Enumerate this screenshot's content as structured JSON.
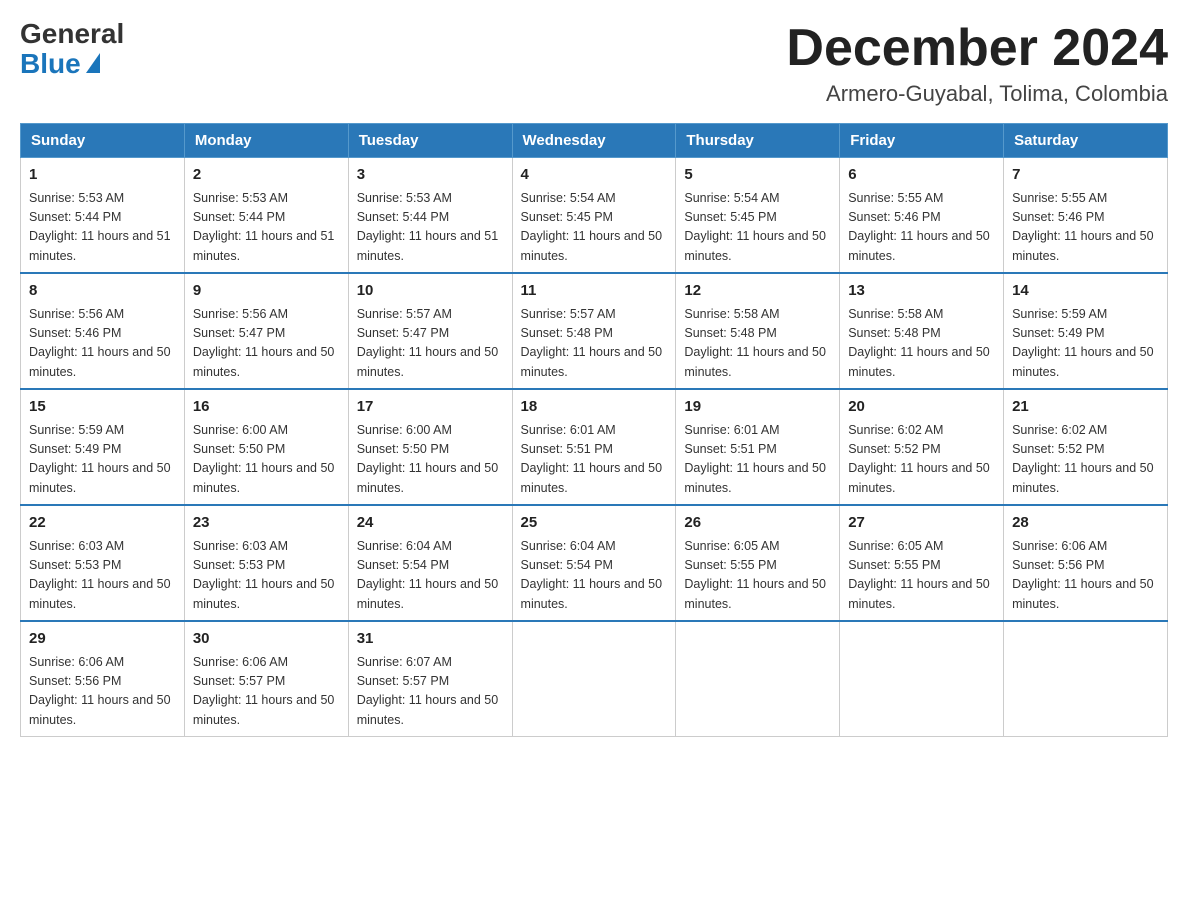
{
  "logo": {
    "general": "General",
    "blue": "Blue"
  },
  "header": {
    "month": "December 2024",
    "location": "Armero-Guyabal, Tolima, Colombia"
  },
  "days_of_week": [
    "Sunday",
    "Monday",
    "Tuesday",
    "Wednesday",
    "Thursday",
    "Friday",
    "Saturday"
  ],
  "weeks": [
    [
      {
        "day": "1",
        "sunrise": "5:53 AM",
        "sunset": "5:44 PM",
        "daylight": "11 hours and 51 minutes."
      },
      {
        "day": "2",
        "sunrise": "5:53 AM",
        "sunset": "5:44 PM",
        "daylight": "11 hours and 51 minutes."
      },
      {
        "day": "3",
        "sunrise": "5:53 AM",
        "sunset": "5:44 PM",
        "daylight": "11 hours and 51 minutes."
      },
      {
        "day": "4",
        "sunrise": "5:54 AM",
        "sunset": "5:45 PM",
        "daylight": "11 hours and 50 minutes."
      },
      {
        "day": "5",
        "sunrise": "5:54 AM",
        "sunset": "5:45 PM",
        "daylight": "11 hours and 50 minutes."
      },
      {
        "day": "6",
        "sunrise": "5:55 AM",
        "sunset": "5:46 PM",
        "daylight": "11 hours and 50 minutes."
      },
      {
        "day": "7",
        "sunrise": "5:55 AM",
        "sunset": "5:46 PM",
        "daylight": "11 hours and 50 minutes."
      }
    ],
    [
      {
        "day": "8",
        "sunrise": "5:56 AM",
        "sunset": "5:46 PM",
        "daylight": "11 hours and 50 minutes."
      },
      {
        "day": "9",
        "sunrise": "5:56 AM",
        "sunset": "5:47 PM",
        "daylight": "11 hours and 50 minutes."
      },
      {
        "day": "10",
        "sunrise": "5:57 AM",
        "sunset": "5:47 PM",
        "daylight": "11 hours and 50 minutes."
      },
      {
        "day": "11",
        "sunrise": "5:57 AM",
        "sunset": "5:48 PM",
        "daylight": "11 hours and 50 minutes."
      },
      {
        "day": "12",
        "sunrise": "5:58 AM",
        "sunset": "5:48 PM",
        "daylight": "11 hours and 50 minutes."
      },
      {
        "day": "13",
        "sunrise": "5:58 AM",
        "sunset": "5:48 PM",
        "daylight": "11 hours and 50 minutes."
      },
      {
        "day": "14",
        "sunrise": "5:59 AM",
        "sunset": "5:49 PM",
        "daylight": "11 hours and 50 minutes."
      }
    ],
    [
      {
        "day": "15",
        "sunrise": "5:59 AM",
        "sunset": "5:49 PM",
        "daylight": "11 hours and 50 minutes."
      },
      {
        "day": "16",
        "sunrise": "6:00 AM",
        "sunset": "5:50 PM",
        "daylight": "11 hours and 50 minutes."
      },
      {
        "day": "17",
        "sunrise": "6:00 AM",
        "sunset": "5:50 PM",
        "daylight": "11 hours and 50 minutes."
      },
      {
        "day": "18",
        "sunrise": "6:01 AM",
        "sunset": "5:51 PM",
        "daylight": "11 hours and 50 minutes."
      },
      {
        "day": "19",
        "sunrise": "6:01 AM",
        "sunset": "5:51 PM",
        "daylight": "11 hours and 50 minutes."
      },
      {
        "day": "20",
        "sunrise": "6:02 AM",
        "sunset": "5:52 PM",
        "daylight": "11 hours and 50 minutes."
      },
      {
        "day": "21",
        "sunrise": "6:02 AM",
        "sunset": "5:52 PM",
        "daylight": "11 hours and 50 minutes."
      }
    ],
    [
      {
        "day": "22",
        "sunrise": "6:03 AM",
        "sunset": "5:53 PM",
        "daylight": "11 hours and 50 minutes."
      },
      {
        "day": "23",
        "sunrise": "6:03 AM",
        "sunset": "5:53 PM",
        "daylight": "11 hours and 50 minutes."
      },
      {
        "day": "24",
        "sunrise": "6:04 AM",
        "sunset": "5:54 PM",
        "daylight": "11 hours and 50 minutes."
      },
      {
        "day": "25",
        "sunrise": "6:04 AM",
        "sunset": "5:54 PM",
        "daylight": "11 hours and 50 minutes."
      },
      {
        "day": "26",
        "sunrise": "6:05 AM",
        "sunset": "5:55 PM",
        "daylight": "11 hours and 50 minutes."
      },
      {
        "day": "27",
        "sunrise": "6:05 AM",
        "sunset": "5:55 PM",
        "daylight": "11 hours and 50 minutes."
      },
      {
        "day": "28",
        "sunrise": "6:06 AM",
        "sunset": "5:56 PM",
        "daylight": "11 hours and 50 minutes."
      }
    ],
    [
      {
        "day": "29",
        "sunrise": "6:06 AM",
        "sunset": "5:56 PM",
        "daylight": "11 hours and 50 minutes."
      },
      {
        "day": "30",
        "sunrise": "6:06 AM",
        "sunset": "5:57 PM",
        "daylight": "11 hours and 50 minutes."
      },
      {
        "day": "31",
        "sunrise": "6:07 AM",
        "sunset": "5:57 PM",
        "daylight": "11 hours and 50 minutes."
      },
      null,
      null,
      null,
      null
    ]
  ]
}
